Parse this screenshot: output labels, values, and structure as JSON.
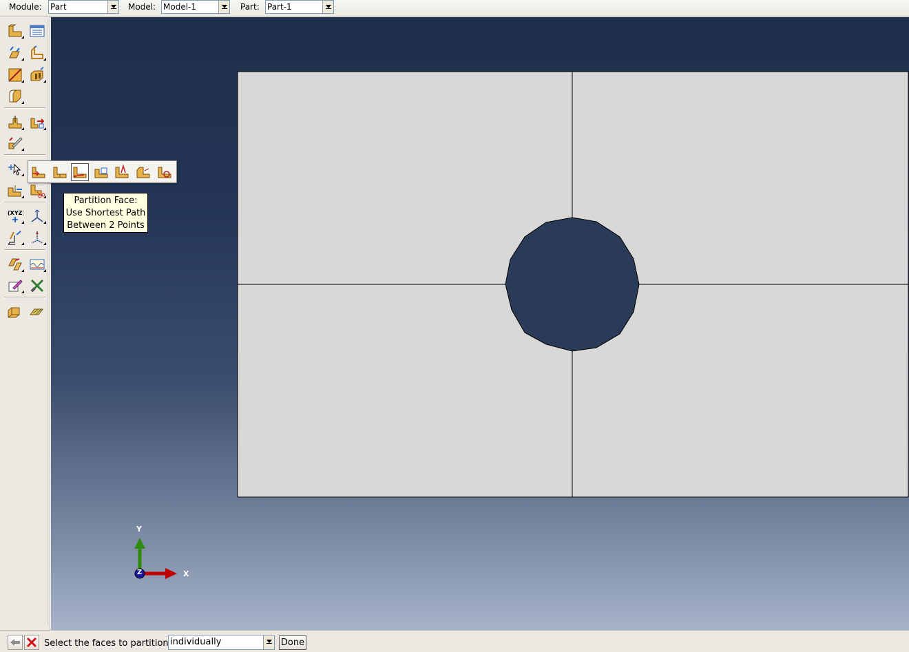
{
  "context_bar": {
    "module_label": "Module:",
    "module_value": "Part",
    "model_label": "Model:",
    "model_value": "Model-1",
    "part_label": "Part:",
    "part_value": "Part-1"
  },
  "toolbox": {
    "icons": [
      "create-part-icon",
      "part-manager-icon",
      "create-solid-extrude-icon",
      "create-shell-icon",
      "create-wire-icon",
      "create-cut-extrude-icon",
      "create-round-fillet-icon",
      "create-datum-point-icon",
      "create-datum-axis-icon",
      "edit-feature-icon",
      "partition-face-sketch-icon",
      "partition-face-icon",
      "partition-cell-icon",
      "partition-edge-icon",
      "datum-point-xyz-icon",
      "datum-csys-icon",
      "query-distance-icon",
      "datum-axis-icon",
      "create-virtual-topology-icon",
      "repair-edges-icon",
      "edit-sketch-icon",
      "tools-icon",
      "assembly-instance-icon",
      "mesh-part-icon"
    ]
  },
  "flyout": {
    "icons": [
      "partition-face-sketch-icon",
      "partition-face-datum-icon",
      "partition-face-shortest-path-icon",
      "partition-face-extend-face-icon",
      "partition-face-intersect-icon",
      "partition-face-project-edges-icon",
      "partition-face-curved-path-icon"
    ],
    "selected": "partition-face-shortest-path-icon"
  },
  "tooltip": {
    "line1": "Partition Face:",
    "line2": "Use Shortest Path",
    "line3": "Between 2 Points"
  },
  "viewport": {
    "triad": {
      "x_label": "X",
      "y_label": "Y",
      "z_label": "Z"
    },
    "colors": {
      "part_face": "#d8d8d8",
      "hole": "#2a3b57",
      "x_axis": "#c00000",
      "y_axis": "#2e8b0e",
      "z_axis": "#1a1aa0"
    }
  },
  "prompt": {
    "back_icon": "back-arrow-icon",
    "cancel_icon": "cancel-x-icon",
    "text": "Select the faces to partition",
    "selection_mode": "individually",
    "done_label": "Done"
  }
}
